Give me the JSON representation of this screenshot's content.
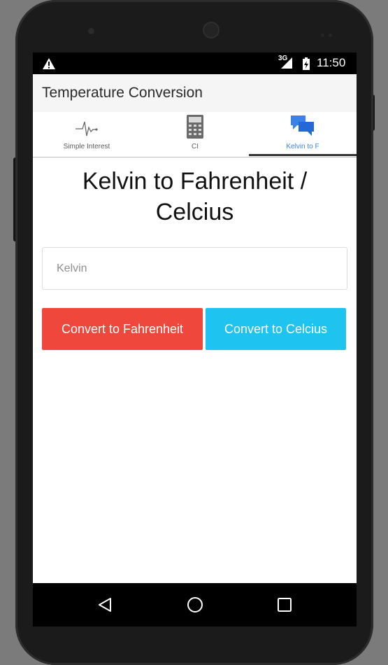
{
  "status_bar": {
    "network": "3G",
    "time": "11:50"
  },
  "app_bar": {
    "title": "Temperature Conversion"
  },
  "tabs": [
    {
      "label": "Simple Interest",
      "icon": "pulse-icon",
      "active": false
    },
    {
      "label": "CI",
      "icon": "calculator-icon",
      "active": false
    },
    {
      "label": "Kelvin to F",
      "icon": "chat-bubbles-icon",
      "active": true
    }
  ],
  "main": {
    "heading_line1": "Kelvin to Fahrenheit /",
    "heading_line2": "Celcius",
    "kelvin_input": {
      "placeholder": "Kelvin",
      "value": ""
    },
    "convert_f_label": "Convert to Fahrenheit",
    "convert_c_label": "Convert to Celcius"
  },
  "colors": {
    "convert_f": "#f0473c",
    "convert_c": "#1ec3ef",
    "active_tab": "#3b82e8"
  }
}
